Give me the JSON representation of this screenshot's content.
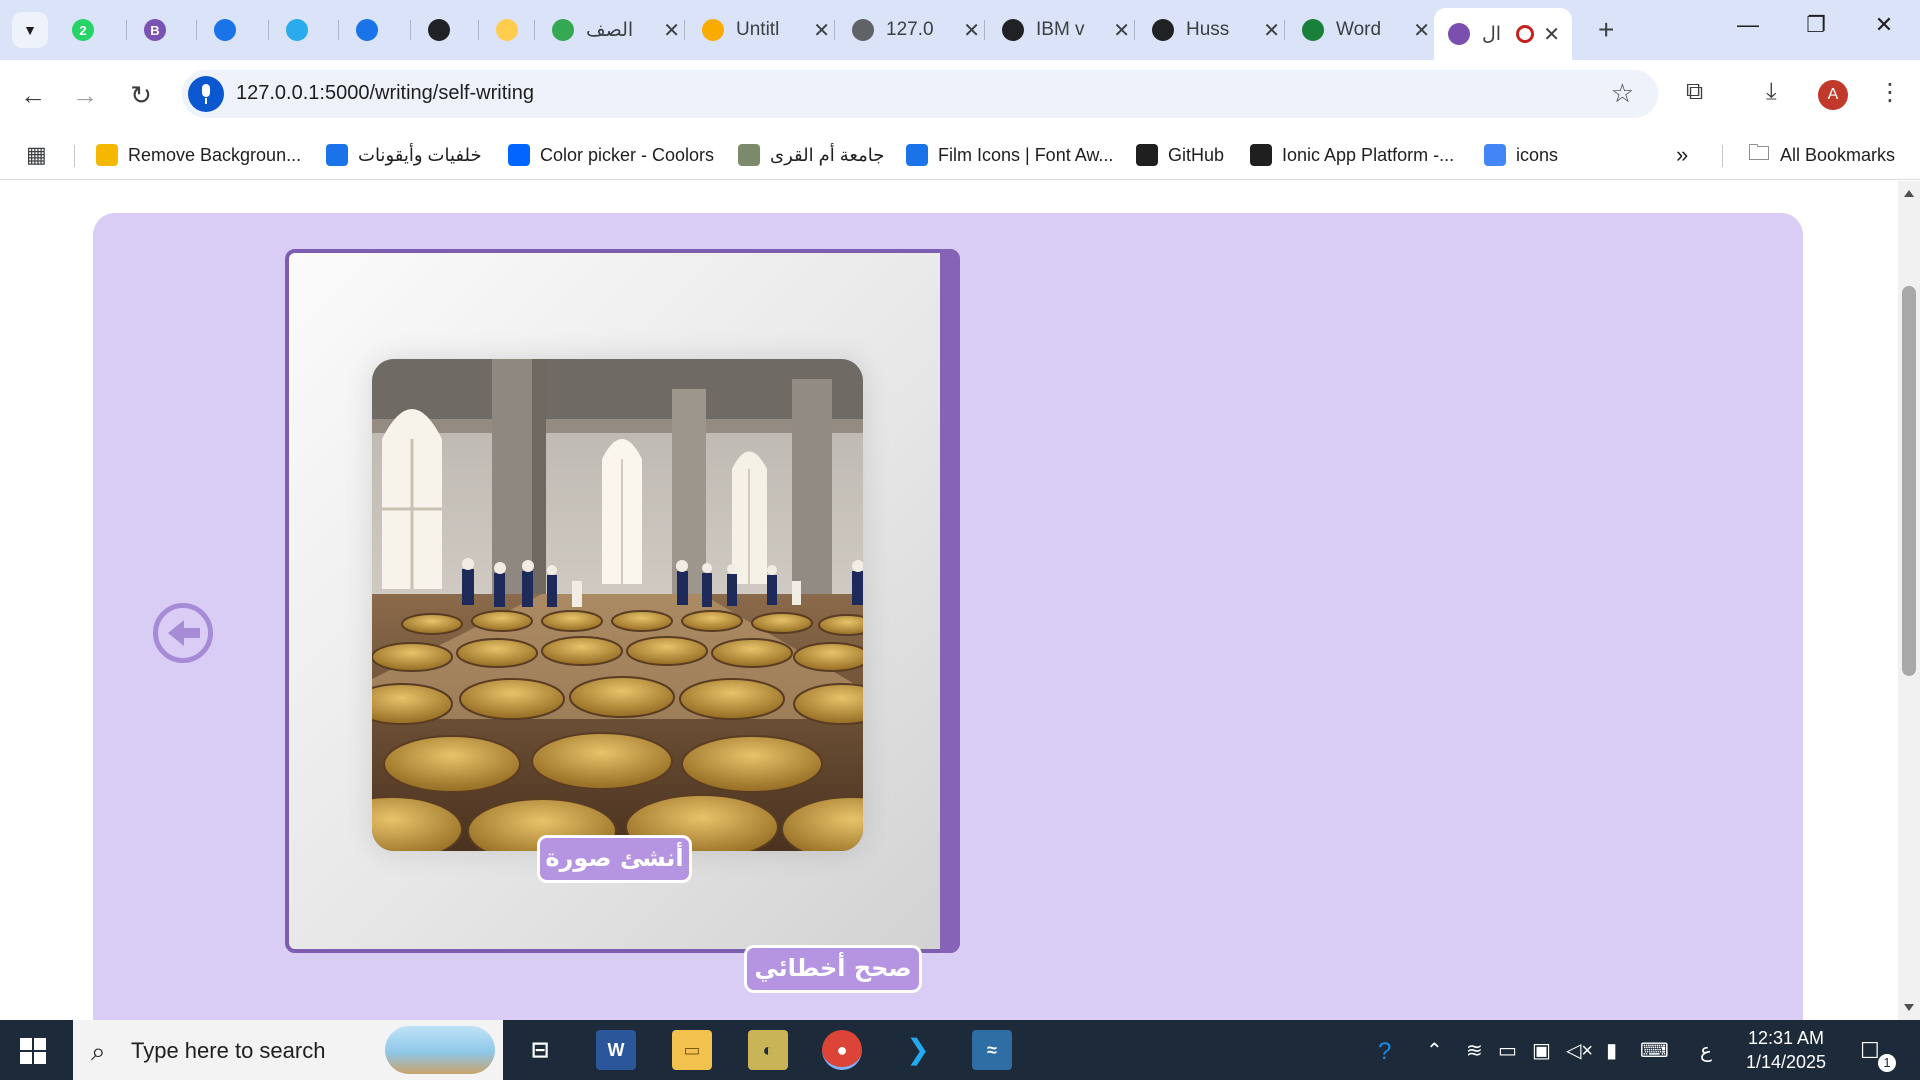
{
  "browser": {
    "tabs": [
      {
        "label": "",
        "favicon": "whatsapp-icon",
        "color": "#25d366",
        "badge": "2"
      },
      {
        "label": "",
        "favicon": "bootstrap-icon",
        "color": "#7952b3",
        "badge": "B"
      },
      {
        "label": "",
        "favicon": "flag-icon",
        "color": "#1a73e8",
        "badge": ""
      },
      {
        "label": "",
        "favicon": "telegram-icon",
        "color": "#2aabee",
        "badge": ""
      },
      {
        "label": "",
        "favicon": "search-icon",
        "color": "#1a73e8",
        "badge": ""
      },
      {
        "label": "",
        "favicon": "openai-icon",
        "color": "#202124",
        "badge": ""
      },
      {
        "label": "",
        "favicon": "huggingface-icon",
        "color": "#ffcc4d",
        "badge": ""
      },
      {
        "label": "الصف",
        "favicon": "google-drive-icon",
        "color": "#34a853",
        "badge": ""
      },
      {
        "label": "Untitl",
        "favicon": "colab-icon",
        "color": "#f9ab00",
        "badge": ""
      },
      {
        "label": "127.0",
        "favicon": "globe-icon",
        "color": "#5f6368",
        "badge": ""
      },
      {
        "label": "IBM v",
        "favicon": "openai-icon",
        "color": "#202124",
        "badge": ""
      },
      {
        "label": "Huss",
        "favicon": "openai-icon",
        "color": "#202124",
        "badge": ""
      },
      {
        "label": "Word",
        "favicon": "globe-icon",
        "color": "#188038",
        "badge": ""
      },
      {
        "label": "ال",
        "favicon": "app-icon",
        "color": "#7b4fb0",
        "badge": ""
      }
    ],
    "url": "127.0.0.1:5000/writing/self-writing",
    "profile_initial": "A",
    "bookmarks": [
      {
        "label": "Remove Backgroun...",
        "icon": "removebg-icon",
        "color": "#f5b700"
      },
      {
        "label": "خلفيات وأيقونات",
        "icon": "document-icon",
        "color": "#1a73e8"
      },
      {
        "label": "Color picker - Coolors",
        "icon": "coolors-icon",
        "color": "#0066ff"
      },
      {
        "label": "جامعة أم القرى",
        "icon": "university-icon",
        "color": "#7a8a6a"
      },
      {
        "label": "Film Icons | Font Aw...",
        "icon": "flag-icon",
        "color": "#1a73e8"
      },
      {
        "label": "GitHub",
        "icon": "github-icon",
        "color": "#1f1f1f"
      },
      {
        "label": "Ionic App Platform -...",
        "icon": "ionic-icon",
        "color": "#1f1f1f"
      },
      {
        "label": "icons",
        "icon": "icons8-icon",
        "color": "#4285f4"
      }
    ],
    "all_bookmarks_label": "All Bookmarks"
  },
  "page": {
    "create_image_label": "أنشئ صورة",
    "fix_mistakes_label": "صحح أخطائي",
    "accent_color": "#7d5db0",
    "panel_color": "#dacdf5"
  },
  "taskbar": {
    "search_placeholder": "Type here to search",
    "keyboard_language": "ع",
    "time": "12:31 AM",
    "date": "1/14/2025",
    "notification_count": "1"
  }
}
